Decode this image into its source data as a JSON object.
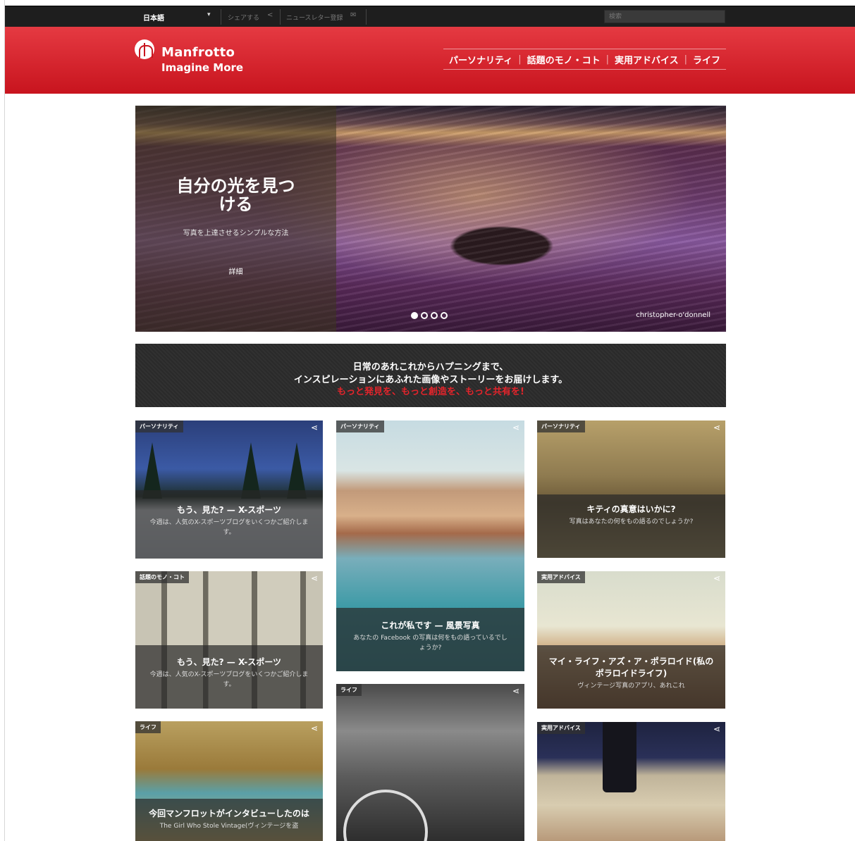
{
  "topbar": {
    "language": "日本語",
    "share": "シェアする",
    "newsletter": "ニュースレター登録",
    "search_placeholder": "検索"
  },
  "header": {
    "brand": "Manfrotto",
    "tagline": "Imagine More",
    "nav": [
      "パーソナリティ",
      "話題のモノ・コト",
      "実用アドバイス",
      "ライフ"
    ],
    "colors": {
      "red_top": "#e53a42",
      "red_bottom": "#c8141e"
    }
  },
  "hero": {
    "title": "自分の光を見つける",
    "subtitle": "写真を上達させるシンプルな方法",
    "more": "詳細",
    "credit": "christopher-o'donnell",
    "slides_total": 4,
    "slide_active": 1
  },
  "banner": {
    "line1": "日常のあれこれからハプニングまで、",
    "line2": "インスピレーションにあふれた画像やストーリーをお届けします。",
    "line3": "もっと発見を、もっと創造を、もっと共有を!"
  },
  "tiles": [
    {
      "category": "パーソナリティ",
      "title": "もう、見た? — X-スポーツ",
      "desc": "今週は、人気のX-スポーツブログをいくつかご紹介します。"
    },
    {
      "category": "パーソナリティ",
      "title": "これが私です — 風景写真",
      "desc": "あなたの Facebook の写真は何をもの語っているでしょうか?"
    },
    {
      "category": "パーソナリティ",
      "title": "キティの真意はいかに?",
      "desc": "写真はあなたの何をもの語るのでしょうか?"
    },
    {
      "category": "話題のモノ・コト",
      "title": "もう、見た? — X-スポーツ",
      "desc": "今週は、人気のX-スポーツブログをいくつかご紹介します。"
    },
    {
      "category": "実用アドバイス",
      "title": "マイ・ライフ・アズ・ア・ポラロイド(私のポラロイドライフ)",
      "desc": "ヴィンテージ写真のアプリ、あれこれ"
    },
    {
      "category": "ライフ",
      "title": "",
      "desc": ""
    },
    {
      "category": "ライフ",
      "title": "今回マンフロットがインタビューしたのは",
      "desc": "The Girl Who Stole Vintage(ヴィンテージを盗"
    },
    {
      "category": "実用アドバイス",
      "title": "",
      "desc": ""
    }
  ],
  "icons": {
    "share": "share-icon",
    "caret": "caret-down-icon",
    "mail": "mail-icon",
    "logo": "manfrotto-logo-icon"
  }
}
